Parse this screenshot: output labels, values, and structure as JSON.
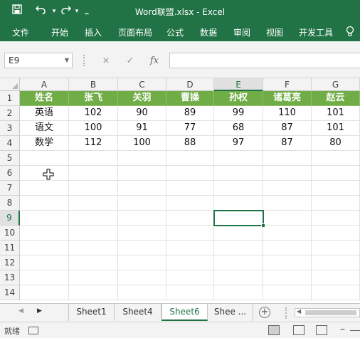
{
  "title_bar": {
    "title": "Word联盟.xlsx - Excel",
    "save_icon": "save-icon",
    "undo_icon": "undo-icon",
    "redo_icon": "redo-icon",
    "customize_icon": "customize-quick-access-icon"
  },
  "ribbon": {
    "tabs": [
      "文件",
      "开始",
      "插入",
      "页面布局",
      "公式",
      "数据",
      "审阅",
      "视图",
      "开发工具"
    ],
    "tell_me_icon": "lightbulb-icon"
  },
  "formula_bar": {
    "name_box": "E9",
    "cancel_icon": "×",
    "enter_icon": "✓",
    "fx_label": "fx",
    "formula_value": ""
  },
  "grid": {
    "columns": [
      "A",
      "B",
      "C",
      "D",
      "E",
      "F",
      "G"
    ],
    "rows": [
      "1",
      "2",
      "3",
      "4",
      "5",
      "6",
      "7",
      "8",
      "9",
      "10",
      "11",
      "12",
      "13",
      "14"
    ],
    "active_column": "E",
    "active_row": "9",
    "cells": [
      [
        "姓名",
        "张飞",
        "关羽",
        "曹操",
        "孙权",
        "诸葛亮",
        "赵云"
      ],
      [
        "英语",
        "102",
        "90",
        "89",
        "99",
        "110",
        "101"
      ],
      [
        "语文",
        "100",
        "91",
        "77",
        "68",
        "87",
        "101"
      ],
      [
        "数学",
        "112",
        "100",
        "88",
        "97",
        "87",
        "80"
      ]
    ],
    "header_fill": "#70ad47",
    "accent": "#217346"
  },
  "sheet_tabs": {
    "tabs": [
      "Sheet1",
      "Sheet4",
      "Sheet6",
      "Shee ..."
    ],
    "active": "Sheet6",
    "add_icon": "+"
  },
  "status_bar": {
    "status": "就绪"
  }
}
